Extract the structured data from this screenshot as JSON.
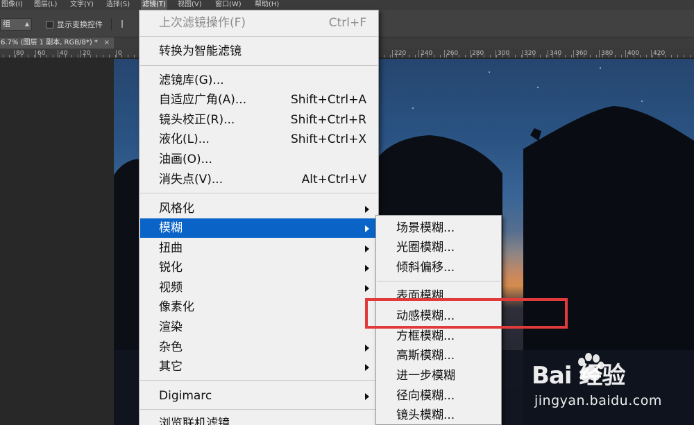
{
  "menubar": {
    "items": [
      {
        "label": "图像(I)"
      },
      {
        "label": "图层(L)"
      },
      {
        "label": "文字(Y)"
      },
      {
        "label": "选择(S)"
      },
      {
        "label": "滤镜(T)"
      },
      {
        "label": "视图(V)"
      },
      {
        "label": "窗口(W)"
      },
      {
        "label": "帮助(H)"
      }
    ]
  },
  "options_bar": {
    "group_select_value": "组",
    "show_transform_label": "显示变换控件"
  },
  "document_tab": {
    "title": "6.7% (图层 1 副本, RGB/8*) *",
    "close_symbol": "×"
  },
  "ruler": {
    "labels": [
      "80",
      "60",
      "40",
      "20",
      "0",
      "220",
      "240",
      "260",
      "280",
      "300",
      "320",
      "340",
      "360",
      "380",
      "400",
      "420"
    ]
  },
  "filter_menu": {
    "items": [
      {
        "label": "上次滤镜操作(F)",
        "shortcut": "Ctrl+F"
      },
      {
        "label": "转换为智能滤镜",
        "shortcut": ""
      },
      {
        "label": "滤镜库(G)...",
        "shortcut": ""
      },
      {
        "label": "自适应广角(A)...",
        "shortcut": "Shift+Ctrl+A"
      },
      {
        "label": "镜头校正(R)...",
        "shortcut": "Shift+Ctrl+R"
      },
      {
        "label": "液化(L)...",
        "shortcut": "Shift+Ctrl+X"
      },
      {
        "label": "油画(O)...",
        "shortcut": ""
      },
      {
        "label": "消失点(V)...",
        "shortcut": "Alt+Ctrl+V"
      },
      {
        "label": "风格化",
        "shortcut": ""
      },
      {
        "label": "模糊",
        "shortcut": ""
      },
      {
        "label": "扭曲",
        "shortcut": ""
      },
      {
        "label": "锐化",
        "shortcut": ""
      },
      {
        "label": "视频",
        "shortcut": ""
      },
      {
        "label": "像素化",
        "shortcut": ""
      },
      {
        "label": "渲染",
        "shortcut": ""
      },
      {
        "label": "杂色",
        "shortcut": ""
      },
      {
        "label": "其它",
        "shortcut": ""
      },
      {
        "label": "Digimarc",
        "shortcut": ""
      },
      {
        "label": "浏览联机滤镜...",
        "shortcut": ""
      }
    ]
  },
  "blur_submenu": {
    "items": [
      {
        "label": "场景模糊..."
      },
      {
        "label": "光圈模糊..."
      },
      {
        "label": "倾斜偏移..."
      },
      {
        "label": "表面模糊..."
      },
      {
        "label": "动感模糊..."
      },
      {
        "label": "方框模糊..."
      },
      {
        "label": "高斯模糊..."
      },
      {
        "label": "进一步模糊"
      },
      {
        "label": "径向模糊..."
      },
      {
        "label": "镜头模糊..."
      }
    ]
  },
  "watermark": {
    "brand": "Bai  经验",
    "url": "jingyan.baidu.com"
  },
  "colors": {
    "menu_highlight": "#0a64c8",
    "annotation_box": "#e13a3a"
  }
}
